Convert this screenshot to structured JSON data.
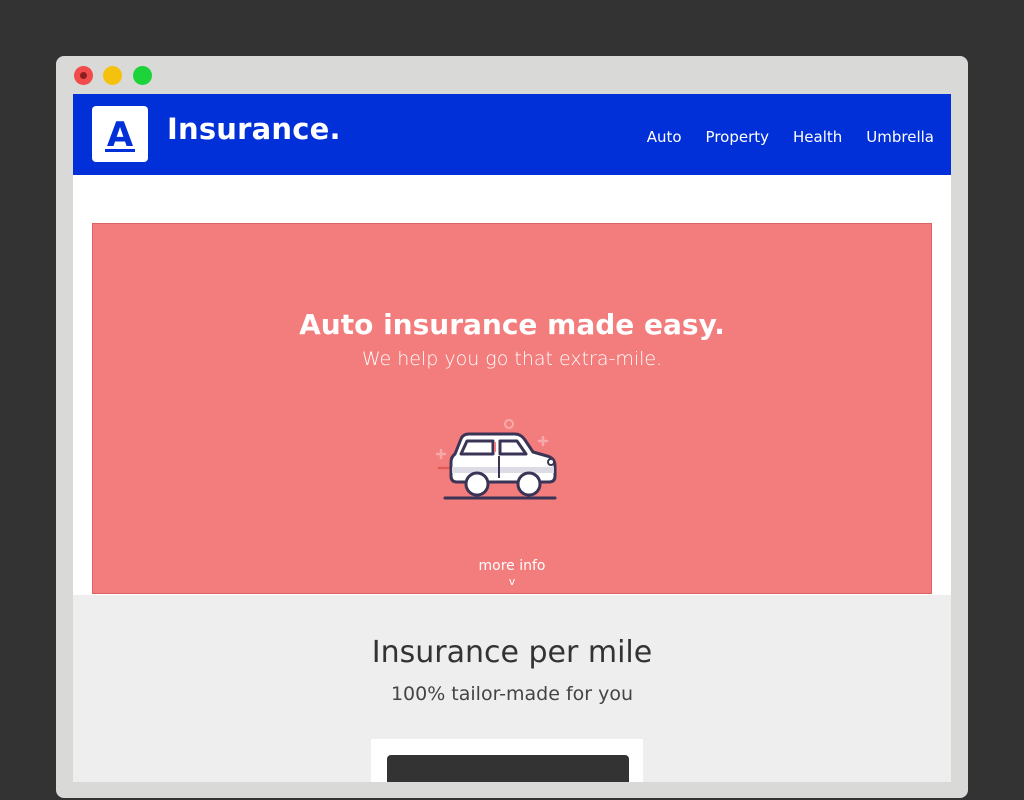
{
  "window": {
    "controls": [
      "close",
      "minimize",
      "maximize"
    ]
  },
  "header": {
    "logo_letter": "A",
    "brand": "Insurance.",
    "nav": [
      {
        "label": "Auto"
      },
      {
        "label": "Property"
      },
      {
        "label": "Health"
      },
      {
        "label": "Umbrella"
      }
    ]
  },
  "hero": {
    "title": "Auto insurance made easy.",
    "subtitle": "We help you go that extra-mile.",
    "illustration": "car-icon",
    "more_info_label": "more info",
    "more_info_chevron": "v"
  },
  "section": {
    "title": "Insurance per mile",
    "subtitle": "100% tailor-made for you"
  },
  "colors": {
    "header_bg": "#0230d8",
    "hero_bg": "#f37c7c",
    "section_bg": "#eeeeee"
  }
}
